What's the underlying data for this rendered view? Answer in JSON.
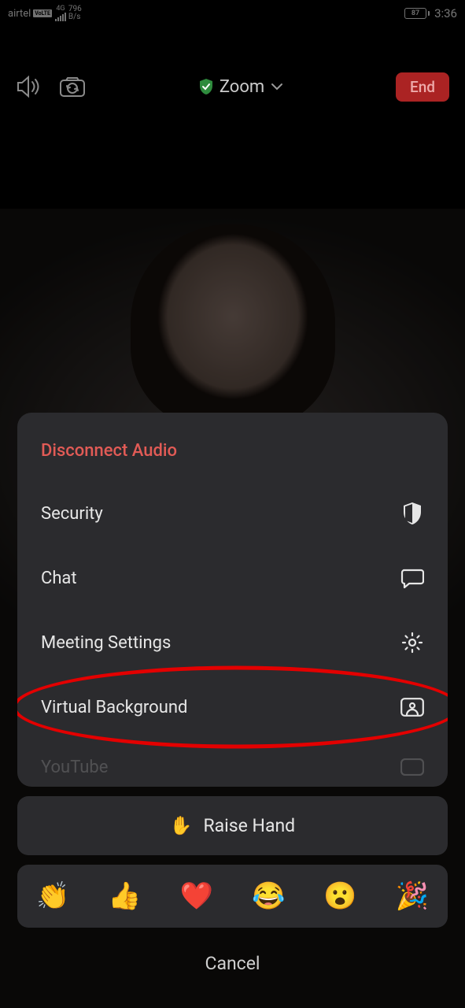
{
  "status": {
    "carrier": "airtel",
    "volte": "VoLTE",
    "network": "4G",
    "speed_top": "796",
    "speed_bottom": "B/s",
    "battery_pct": "87",
    "time": "3:36"
  },
  "top": {
    "title": "Zoom",
    "end_label": "End"
  },
  "sheet": {
    "items": [
      {
        "label": "Disconnect Audio",
        "danger": true
      },
      {
        "label": "Security"
      },
      {
        "label": "Chat"
      },
      {
        "label": "Meeting Settings"
      },
      {
        "label": "Virtual Background",
        "highlighted": true
      },
      {
        "label": "YouTube"
      }
    ],
    "raise_hand": "Raise Hand",
    "reactions": [
      "👏",
      "👍",
      "❤️",
      "😂",
      "😮",
      "🎉"
    ],
    "cancel": "Cancel"
  }
}
